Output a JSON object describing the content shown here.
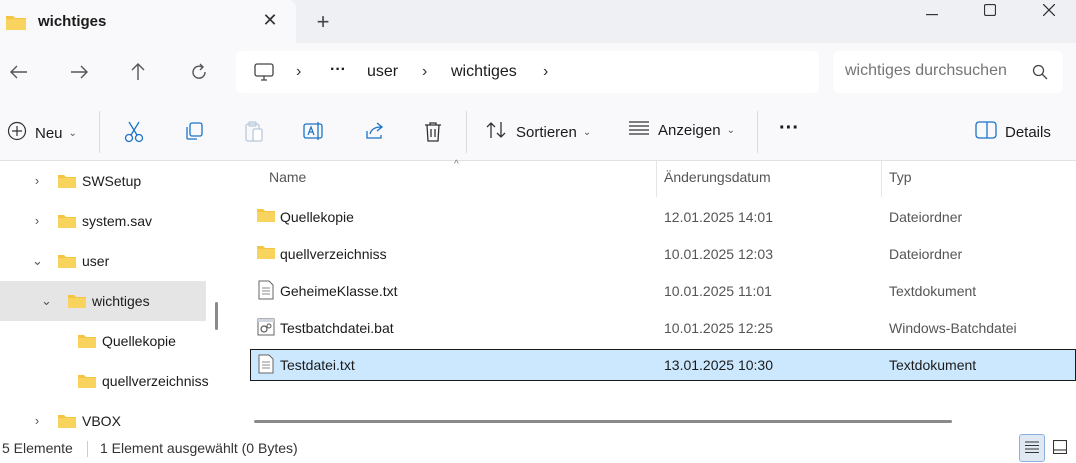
{
  "tab": {
    "title": "wichtiges",
    "close_glyph": "✕",
    "new_tab_glyph": "+",
    "icon": "folder-icon"
  },
  "window_controls": {
    "minimize": "minimize-icon",
    "maximize": "maximize-icon",
    "close": "close-icon"
  },
  "nav": {
    "back": "arrow-left-icon",
    "forward": "arrow-right-icon",
    "up": "arrow-up-icon",
    "refresh": "refresh-icon"
  },
  "address": {
    "ellipsis": "···",
    "parts": [
      "user",
      "wichtiges"
    ]
  },
  "search": {
    "placeholder": "wichtiges durchsuchen"
  },
  "toolbar": {
    "new_label": "Neu",
    "sort_label": "Sortieren",
    "view_label": "Anzeigen",
    "more": "···",
    "details_label": "Details"
  },
  "sidebar": {
    "items": [
      {
        "label": "SWSetup",
        "expanded": false
      },
      {
        "label": "system.sav",
        "expanded": false
      },
      {
        "label": "user",
        "expanded": true
      },
      {
        "label": "wichtiges",
        "expanded": true,
        "selected": true
      },
      {
        "label": "Quellekopie"
      },
      {
        "label": "quellverzeichniss"
      },
      {
        "label": "VBOX",
        "expanded": false
      }
    ]
  },
  "columns": {
    "name": "Name",
    "date": "Änderungsdatum",
    "type": "Typ"
  },
  "files": [
    {
      "name": "Quellekopie",
      "date": "12.01.2025 14:01",
      "type": "Dateiordner",
      "icon": "folder-icon"
    },
    {
      "name": "quellverzeichniss",
      "date": "10.01.2025 12:03",
      "type": "Dateiordner",
      "icon": "folder-icon"
    },
    {
      "name": "GeheimeKlasse.txt",
      "date": "10.01.2025 11:01",
      "type": "Textdokument",
      "icon": "text-file-icon"
    },
    {
      "name": "Testbatchdatei.bat",
      "date": "10.01.2025 12:25",
      "type": "Windows-Batchdatei",
      "icon": "batch-file-icon"
    },
    {
      "name": "Testdatei.txt",
      "date": "13.01.2025 10:30",
      "type": "Textdokument",
      "icon": "text-file-icon",
      "selected": true
    }
  ],
  "status": {
    "count": "5 Elemente",
    "selection": "1 Element ausgewählt (0 Bytes)"
  },
  "colors": {
    "folder": "#f4c542",
    "selection": "#cce8ff",
    "accent": "#1a73c8"
  }
}
